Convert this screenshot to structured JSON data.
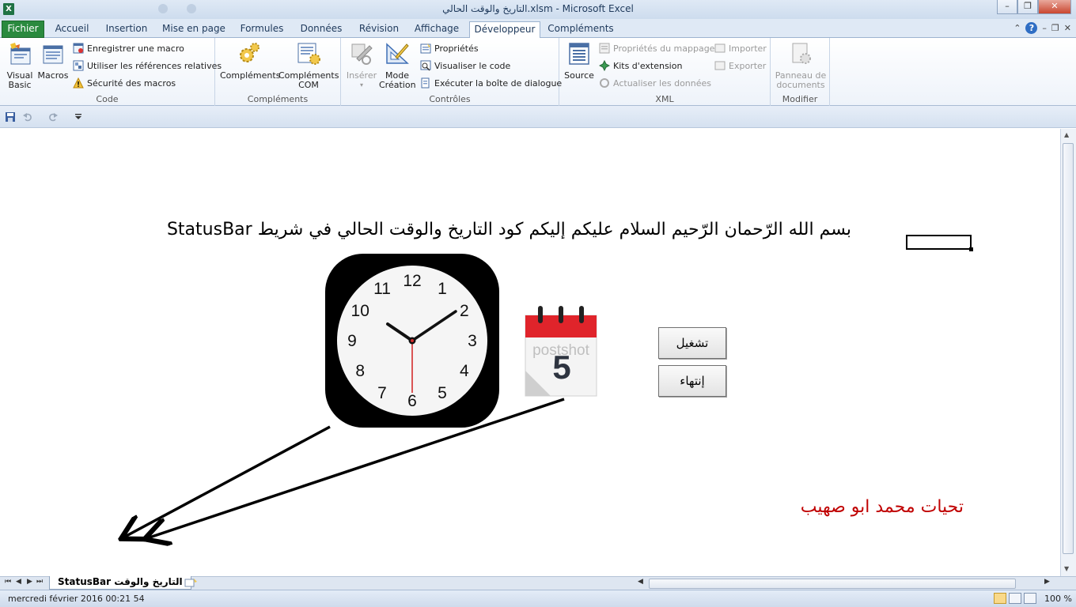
{
  "window": {
    "title": "التاريخ والوقت الحالي.xlsm  -  Microsoft Excel",
    "controls": [
      "–",
      "❐",
      "✕"
    ]
  },
  "tabs": {
    "file": "Fichier",
    "items": [
      "Accueil",
      "Insertion",
      "Mise en page",
      "Formules",
      "Données",
      "Révision",
      "Affichage",
      "Développeur",
      "Compléments"
    ],
    "active": "Développeur"
  },
  "ribbon": {
    "code": {
      "label": "Code",
      "visual_basic": "Visual\nBasic",
      "macros": "Macros",
      "record_macro": "Enregistrer une macro",
      "relative_refs": "Utiliser les références relatives",
      "macro_security": "Sécurité des macros"
    },
    "addins": {
      "label": "Compléments",
      "addins": "Compléments",
      "com_addins": "Compléments\nCOM"
    },
    "controls": {
      "label": "Contrôles",
      "insert": "Insérer",
      "design_mode": "Mode\nCréation",
      "properties": "Propriétés",
      "view_code": "Visualiser le code",
      "run_dialog": "Exécuter la boîte de dialogue"
    },
    "xml": {
      "label": "XML",
      "source": "Source",
      "map_properties": "Propriétés du mappage",
      "expansion_packs": "Kits d'extension",
      "refresh_data": "Actualiser les données",
      "import": "Importer",
      "export": "Exporter"
    },
    "modify": {
      "label": "Modifier",
      "document_panel": "Panneau de\ndocuments"
    }
  },
  "sheet": {
    "headline": "بسم الله الرّحمان الرّحيم السلام عليكم إليكم كود التاريخ والوقت الحالي في شريط StatusBar",
    "clock_numbers": [
      "12",
      "1",
      "2",
      "3",
      "4",
      "5",
      "6",
      "7",
      "8",
      "9",
      "10",
      "11"
    ],
    "calendar_day": "5",
    "calendar_watermark": "postshot",
    "start_button": "تشغيل",
    "stop_button": "إنتهاء",
    "greeting": "تحيات محمد ابو صهيب"
  },
  "sheet_tabs": {
    "active": "التاريخ والوقت StatusBar"
  },
  "statusbar": {
    "text": "mercredi février 2016   00:21 54",
    "zoom": "100 %"
  },
  "colors": {
    "file_tab": "#2a8a3e",
    "greeting": "#c00000",
    "calendar_red": "#e0242b"
  }
}
